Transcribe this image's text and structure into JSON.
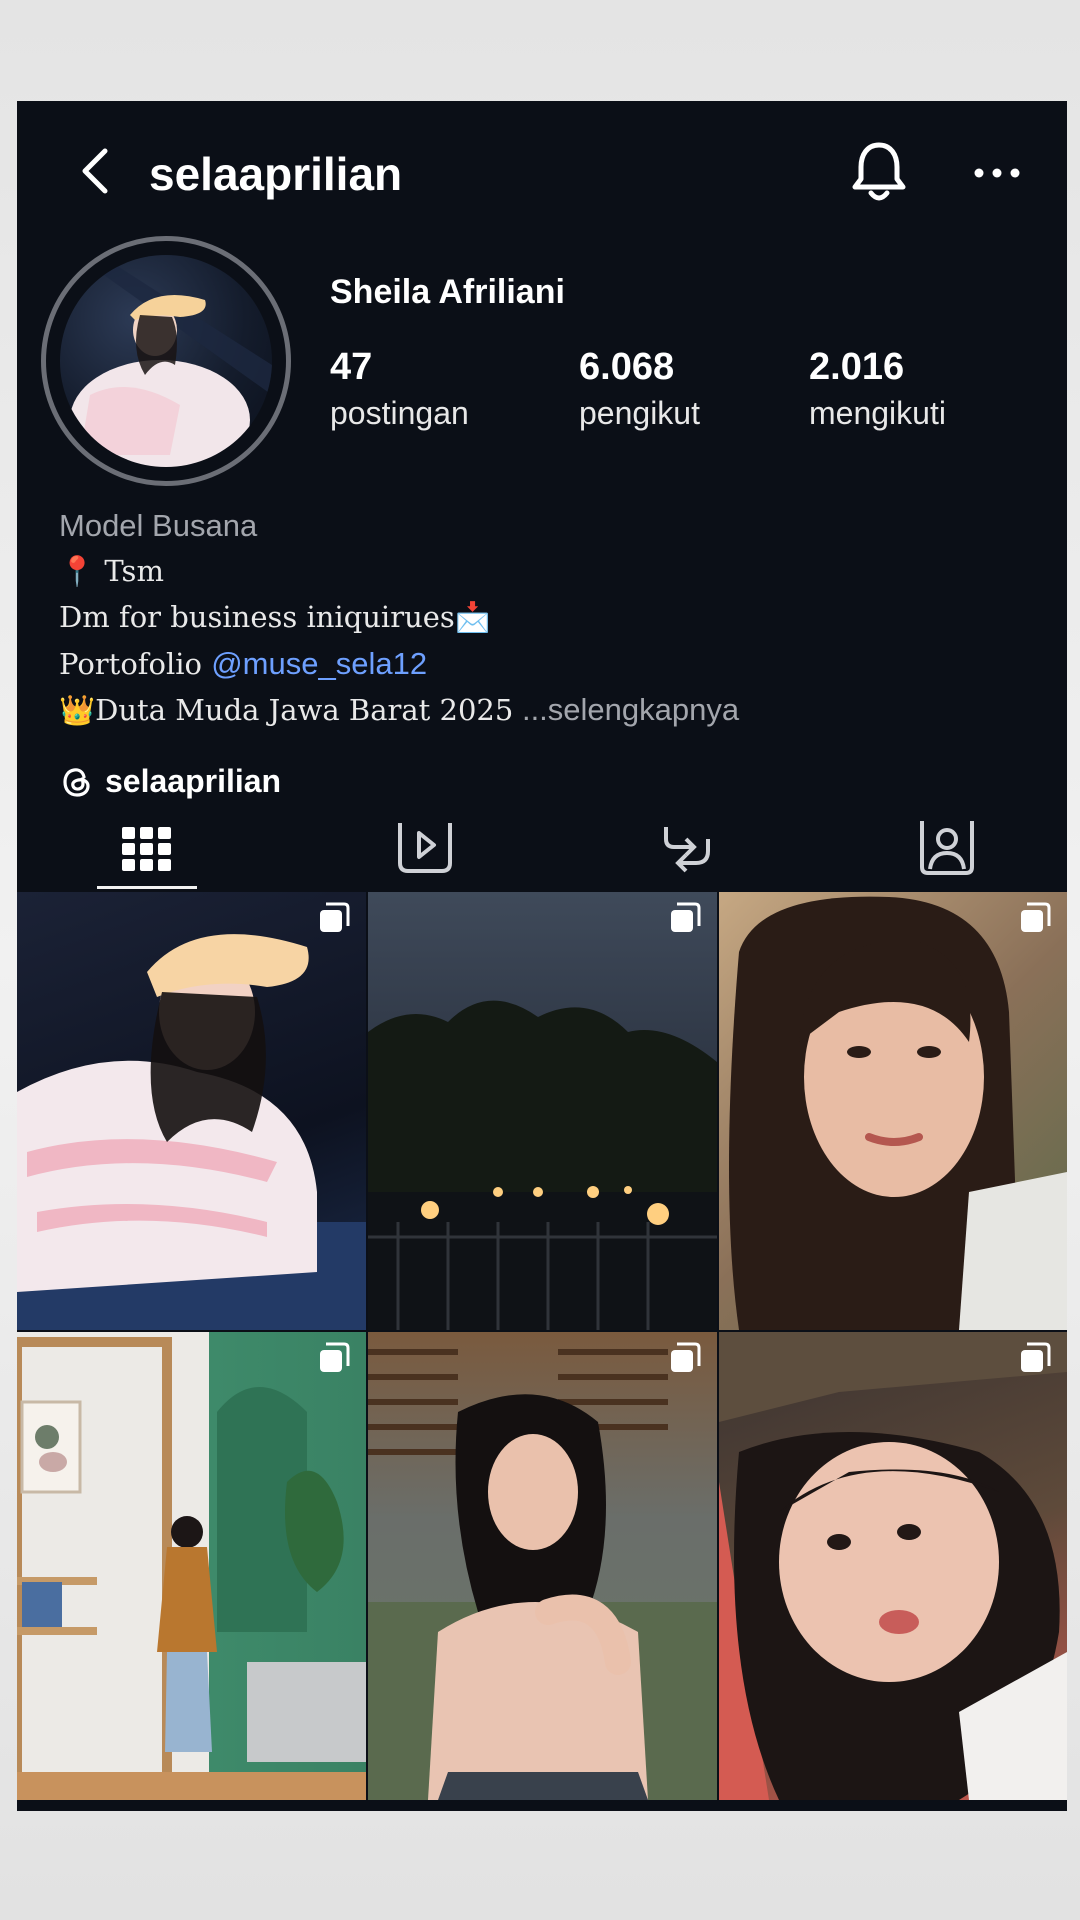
{
  "header": {
    "username": "selaaprilian"
  },
  "profile": {
    "display_name": "Sheila Afriliani",
    "stats": [
      {
        "value": "47",
        "label": "postingan"
      },
      {
        "value": "6.068",
        "label": "pengikut"
      },
      {
        "value": "2.016",
        "label": "mengikuti"
      }
    ],
    "category": "Model Busana",
    "bio": {
      "line1": "📍 Tsm",
      "line2": "Dm for business iniquirues📩",
      "line3_prefix": "Portofolio ",
      "line3_mention": "@muse_sela12",
      "line4": "👑Duta Muda Jawa Barat 2025",
      "more": "...selengkapnya"
    },
    "threads_handle": "selaaprilian"
  },
  "tabs": [
    "grid-icon",
    "reels-icon",
    "reposts-icon",
    "tagged-icon"
  ],
  "colors": {
    "background": "#0b0f17",
    "mention": "#6ea0ff",
    "muted": "#a3a6ad"
  }
}
